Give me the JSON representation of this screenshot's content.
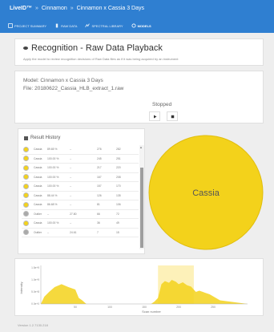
{
  "app": {
    "brand": "LiveID™",
    "breadcrumb": [
      "Cinnamon",
      "Cinnamon x Cassia 3 Days"
    ],
    "tabs": [
      {
        "label": "Project Summary",
        "icon": "summary-icon"
      },
      {
        "label": "Raw Data",
        "icon": "raw-data-icon"
      },
      {
        "label": "Spectral Library",
        "icon": "library-icon"
      },
      {
        "label": "Models",
        "icon": "models-icon",
        "active": true
      }
    ]
  },
  "header": {
    "title": "Recognition - Raw Data Playback",
    "subtitle": "Apply the model to review recognition decisions of Raw Data files as if it was being acquired by an instrument"
  },
  "model": {
    "model_line": "Model: Cinnamon x Cassia 3 Days",
    "file_line": "File: 20180622_Cassia_HLB_extract_1.raw",
    "status": "Stopped"
  },
  "history": {
    "title": "Result History",
    "rows": [
      {
        "type": "yellow",
        "name": "Cassia",
        "pct": "89.65 %",
        "a": "--",
        "b": "276",
        "c": "282"
      },
      {
        "type": "yellow",
        "name": "Cassia",
        "pct": "100.00 %",
        "a": "--",
        "b": "245",
        "c": "251"
      },
      {
        "type": "yellow",
        "name": "Cassia",
        "pct": "100.00 %",
        "a": "--",
        "b": "217",
        "c": "220"
      },
      {
        "type": "yellow",
        "name": "Cassia",
        "pct": "100.00 %",
        "a": "--",
        "b": "167",
        "c": "208"
      },
      {
        "type": "yellow",
        "name": "Cassia",
        "pct": "100.00 %",
        "a": "--",
        "b": "157",
        "c": "170"
      },
      {
        "type": "yellow",
        "name": "Cassia",
        "pct": "88.44 %",
        "a": "--",
        "b": "126",
        "c": "135"
      },
      {
        "type": "yellow",
        "name": "Cassia",
        "pct": "86.68 %",
        "a": "--",
        "b": "81",
        "c": "106"
      },
      {
        "type": "gray",
        "name": "Outlier",
        "pct": "--",
        "a": "27.80",
        "b": "66",
        "c": "72"
      },
      {
        "type": "yellow",
        "name": "Cassia",
        "pct": "100.00 %",
        "a": "--",
        "b": "36",
        "c": "49"
      },
      {
        "type": "gray",
        "name": "Outlier",
        "pct": "--",
        "a": "24.61",
        "b": "7",
        "c": "15"
      }
    ]
  },
  "result": {
    "label": "Cassia",
    "color": "#f3d21b"
  },
  "chart_data": {
    "type": "area",
    "title": "",
    "xlabel": "Scan number",
    "ylabel": "Intensity",
    "xlim": [
      0,
      300
    ],
    "ylim": [
      0,
      1600000000
    ],
    "x_ticks": [
      50,
      100,
      150,
      200,
      250
    ],
    "y_ticks": [
      "0.0e+0",
      "5.0e+8",
      "1.0e+9",
      "1.5e+9"
    ],
    "highlight_range": [
      170,
      222
    ],
    "color": "#f3d21b",
    "series": [
      {
        "x": [
          0,
          5,
          12,
          20,
          30,
          40,
          50,
          55,
          60,
          64,
          66,
          90,
          140,
          160,
          165,
          170,
          175,
          180,
          186,
          190,
          196,
          200,
          206,
          212,
          218,
          225,
          230,
          245,
          260,
          300
        ],
        "y": [
          0,
          300000000,
          500000000,
          700000000,
          820000000,
          700000000,
          600000000,
          250000000,
          150000000,
          50000000,
          0,
          0,
          0,
          0,
          100000000,
          250000000,
          820000000,
          950000000,
          880000000,
          1000000000,
          920000000,
          820000000,
          900000000,
          780000000,
          720000000,
          500000000,
          550000000,
          400000000,
          150000000,
          0
        ]
      }
    ]
  },
  "footer": {
    "version": "Version 1.2.7130.218"
  }
}
